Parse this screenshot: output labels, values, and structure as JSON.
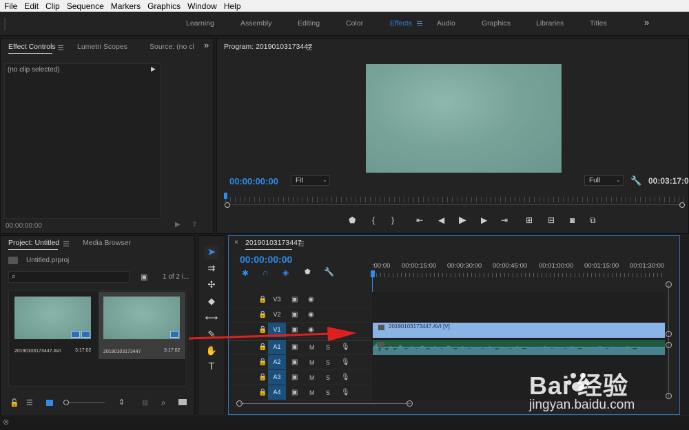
{
  "menu": [
    "File",
    "Edit",
    "Clip",
    "Sequence",
    "Markers",
    "Graphics",
    "Window",
    "Help"
  ],
  "workspaces": [
    {
      "label": "Learning",
      "active": false
    },
    {
      "label": "Assembly",
      "active": false
    },
    {
      "label": "Editing",
      "active": false
    },
    {
      "label": "Color",
      "active": false
    },
    {
      "label": "Effects",
      "active": true
    },
    {
      "label": "Audio",
      "active": false
    },
    {
      "label": "Graphics",
      "active": false
    },
    {
      "label": "Libraries",
      "active": false
    },
    {
      "label": "Titles",
      "active": false
    }
  ],
  "source_panel": {
    "tabs": [
      "Effect Controls",
      "Lumetri Scopes",
      "Source: (no cl"
    ],
    "no_clip": "(no clip selected)",
    "timecode": "00:00:00:00"
  },
  "program": {
    "title": "Program: 20190103173447",
    "timecode": "00:00:00:00",
    "fit": "Fit",
    "quality": "Full",
    "duration": "00:03:17:0"
  },
  "project": {
    "tabs": [
      "Project: Untitled",
      "Media Browser"
    ],
    "file": "Untitled.prproj",
    "count": "1 of 2 i...",
    "items": [
      {
        "name": "20190103173447.AVI",
        "duration": "3:17:02"
      },
      {
        "name": "20190103173447",
        "duration": "3:17:02"
      }
    ]
  },
  "timeline": {
    "sequence": "20190103173447",
    "timecode": "00:00:00:00",
    "ruler": [
      ":00:00",
      "00:00:15:00",
      "00:00:30:00",
      "00:00:45:00",
      "00:01:00:00",
      "00:01:15:00",
      "00:01:30:00"
    ],
    "video_tracks": [
      "V3",
      "V2",
      "V1"
    ],
    "audio_tracks": [
      "A1",
      "A2",
      "A3",
      "A4"
    ],
    "clip_label": "20190103173447.AVI [V]",
    "mute_label": "M",
    "solo_label": "S"
  },
  "watermark": {
    "brand": "Bai  经验",
    "url": "jingyan.baidu.com"
  },
  "colors": {
    "accent": "#2d8ceb",
    "clip": "#8ab4e6",
    "arrow": "#e02020"
  }
}
